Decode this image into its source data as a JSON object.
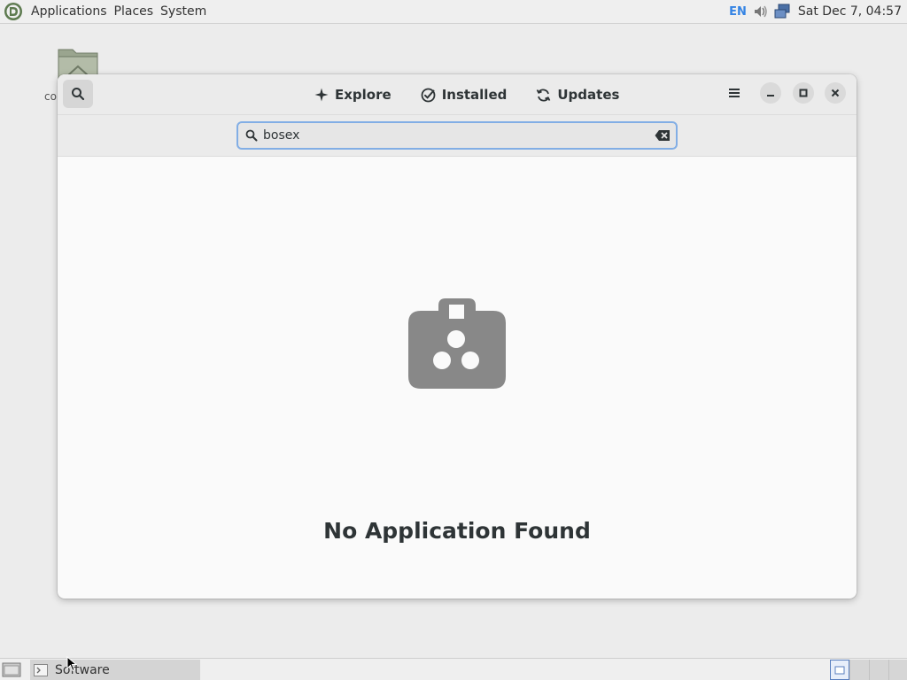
{
  "top_panel": {
    "menus": [
      "Applications",
      "Places",
      "System"
    ],
    "keyboard_layout": "EN",
    "clock": "Sat Dec 7, 04:57"
  },
  "desktop": {
    "icon_label": "co"
  },
  "window": {
    "tabs": [
      {
        "label": "Explore",
        "icon": "sparkle-icon"
      },
      {
        "label": "Installed",
        "icon": "check-circle-icon"
      },
      {
        "label": "Updates",
        "icon": "refresh-icon"
      }
    ],
    "search": {
      "value": "bosex"
    },
    "empty_state": {
      "title": "No Application Found",
      "icon": "shopping-bag-icon"
    }
  },
  "taskbar": {
    "task_label": "Software"
  },
  "colors": {
    "accent": "#3584e4",
    "focus_ring": "#82aee5",
    "empty_icon": "#888888"
  }
}
